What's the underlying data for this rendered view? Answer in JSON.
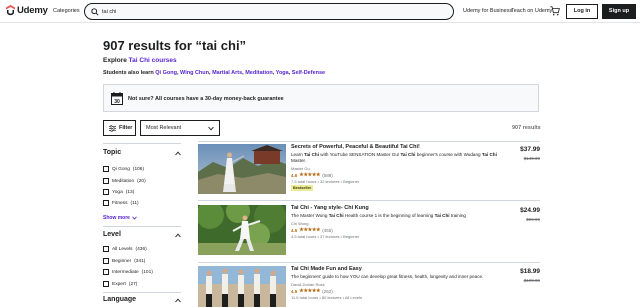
{
  "header": {
    "logo_text": "Udemy",
    "categories_label": "Categories",
    "search_value": "tai chi",
    "business_link": "Udemy for Business",
    "teach_link": "Teach on Udemy",
    "login_label": "Log in",
    "signup_label": "Sign up",
    "brand_color": "#ec5252"
  },
  "main": {
    "title": "907 results for “tai chi”",
    "explore_prefix": "Explore",
    "explore_link": "Tai Chi courses",
    "also_prefix": "Students also learn",
    "also_links": [
      "Qi Gong",
      "Wing Chun",
      "Martial Arts",
      "Meditation",
      "Yoga",
      "Self-Defense"
    ],
    "banner_text": "Not sure? All courses have a 30-day money-back guarantee",
    "filter_label": "Filter",
    "sort_value": "Most Relevant",
    "results_count": "907 results"
  },
  "sidebar": {
    "topic": {
      "heading": "Topic",
      "items": [
        {
          "label": "Qi Gong",
          "count": "(106)"
        },
        {
          "label": "Meditation",
          "count": "(20)"
        },
        {
          "label": "Yoga",
          "count": "(13)"
        },
        {
          "label": "Fitness",
          "count": "(11)"
        }
      ],
      "show_more": "Show more"
    },
    "level": {
      "heading": "Level",
      "items": [
        {
          "label": "All Levels",
          "count": "(436)"
        },
        {
          "label": "Beginner",
          "count": "(341)"
        },
        {
          "label": "Intermediate",
          "count": "(101)"
        },
        {
          "label": "Expert",
          "count": "(27)"
        }
      ]
    },
    "language": {
      "heading": "Language"
    }
  },
  "courses": [
    {
      "title": "Secrets of Powerful, Peaceful & Beautiful Tai Chi!",
      "desc_pre": "Learn ",
      "desc_b1": "Tai Chi",
      "desc_mid": " with YouTube SENSATION Master Gu! ",
      "desc_b2": "Tai Chi",
      "desc_post": " beginner's course with Wudang ",
      "desc_b3": "Tai Chi",
      "desc_end": " Master.",
      "author": "Master Gu",
      "rating": "4.6",
      "stars": "★★★★★",
      "reviews": "(588)",
      "meta": "7.5 total hours • 32 lectures • Beginner",
      "badge": "Bestseller",
      "price": "$37.99",
      "original_price": "$149.99"
    },
    {
      "title": "Tai Chi - Yang style- Chi Kung",
      "desc_pre": "The Master Wong ",
      "desc_b1": "Tai Chi",
      "desc_mid": " Health course 1 is the beginning of learning ",
      "desc_b2": "Tai Chi",
      "desc_post": " training",
      "desc_b3": "",
      "desc_end": "",
      "author": "Chi Wong",
      "rating": "4.5",
      "stars": "★★★★★",
      "reviews": "(465)",
      "meta": "4.5 total hours • 37 lectures • Beginner",
      "badge": "",
      "price": "$24.99",
      "original_price": "$99.99"
    },
    {
      "title": "Tai Chi Made Fun and Easy",
      "desc_pre": "The beginners' guide to how YOU can develop great fitness, health, longevity and inner peace.",
      "desc_b1": "",
      "desc_mid": "",
      "desc_b2": "",
      "desc_post": "",
      "desc_b3": "",
      "desc_end": "",
      "author": "David-Dorian Ross",
      "rating": "4.5",
      "stars": "★★★★★",
      "reviews": "(262)",
      "meta": "11.5 total hours • 80 lectures • All Levels",
      "badge": "",
      "price": "$18.99",
      "original_price": "$109.99"
    }
  ]
}
